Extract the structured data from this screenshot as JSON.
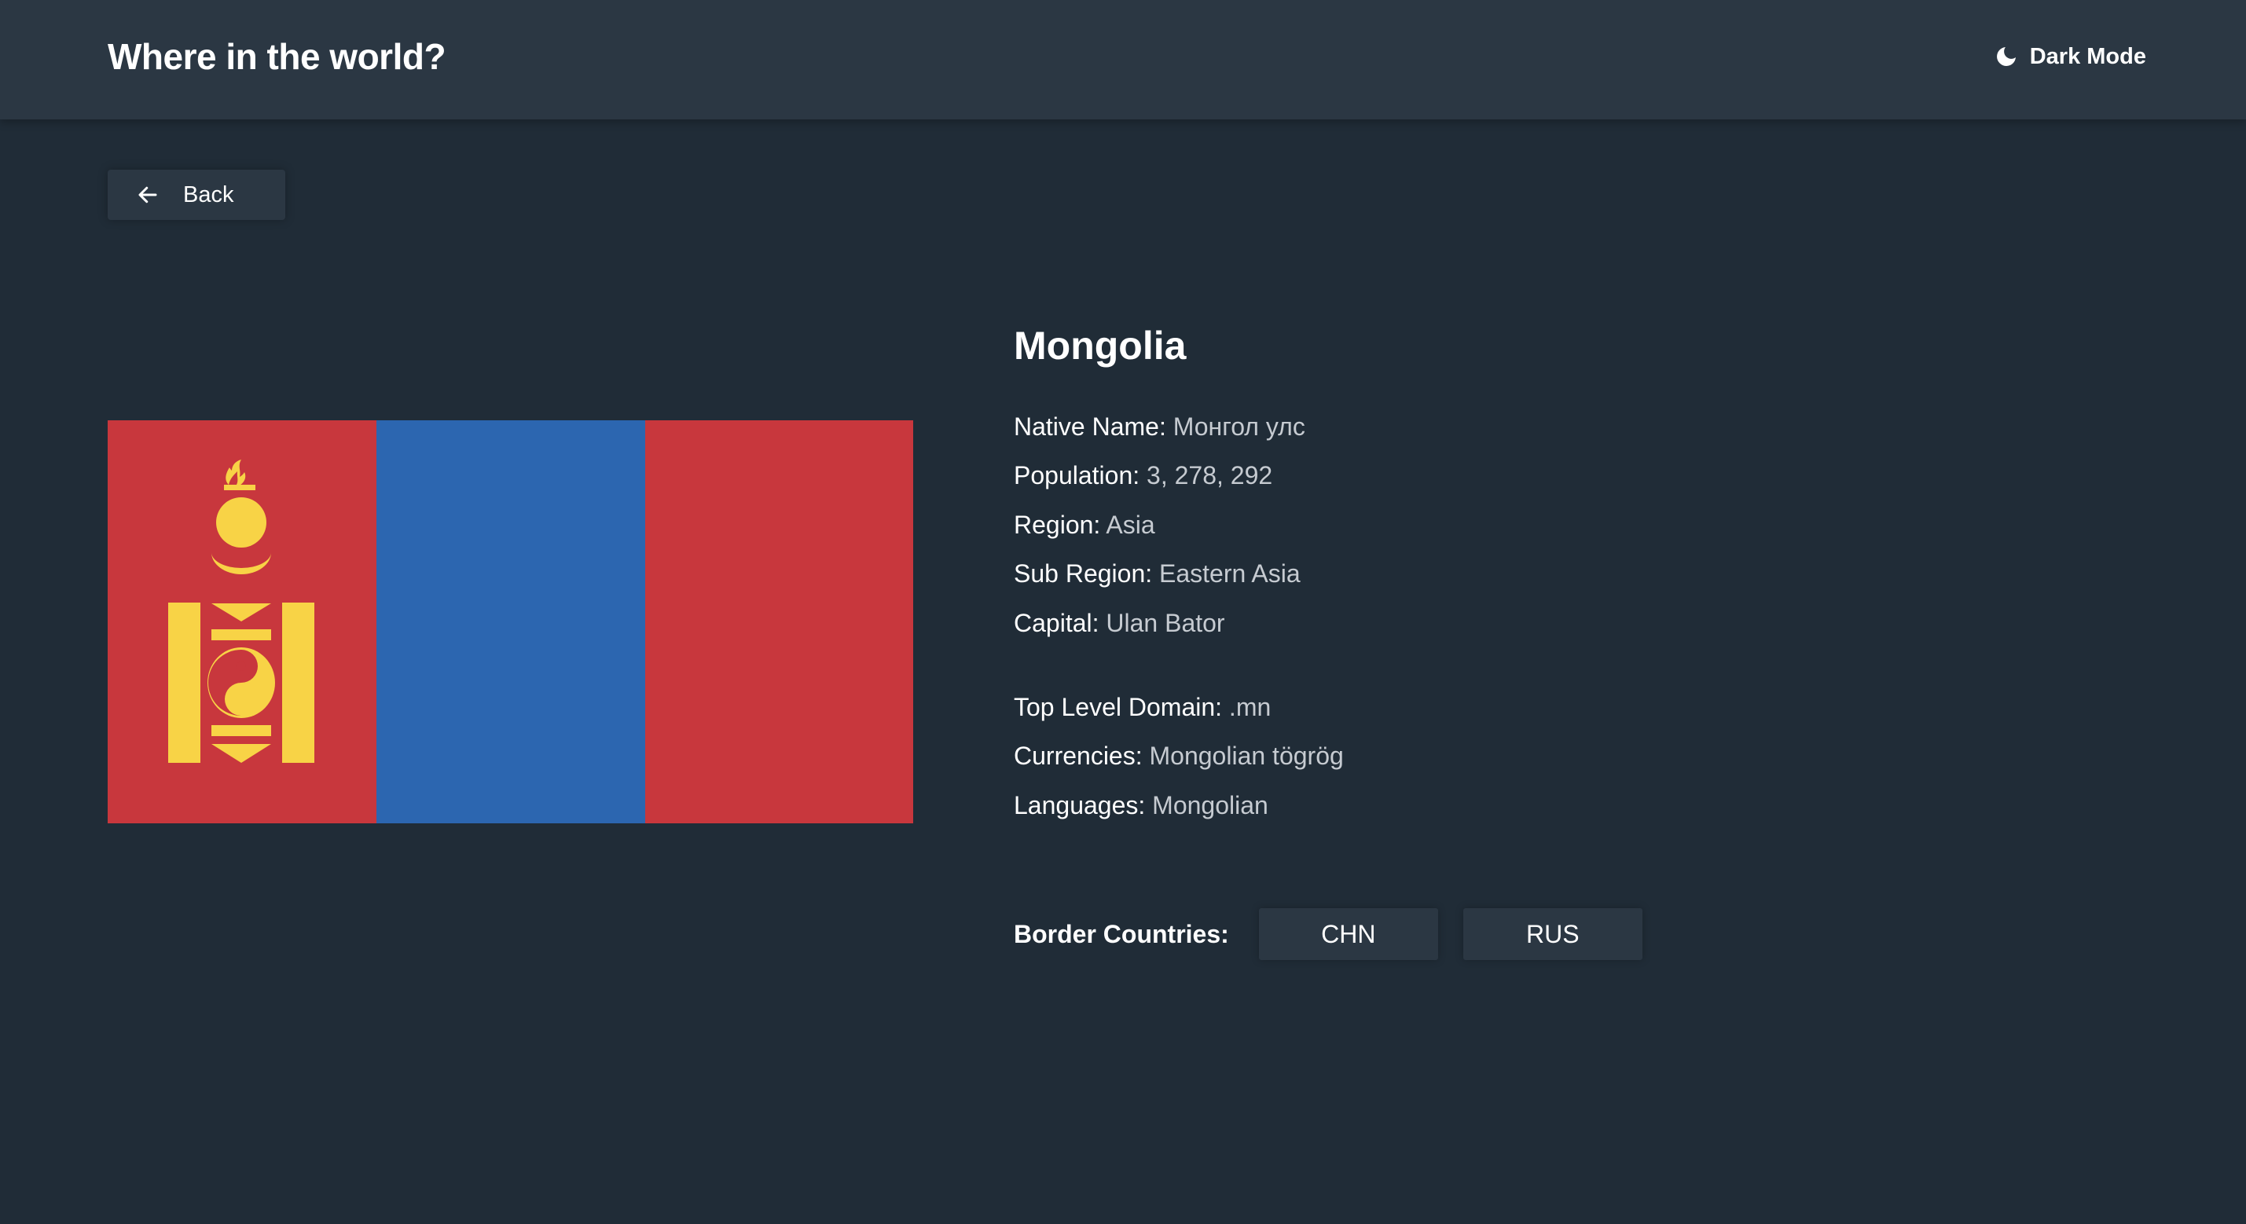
{
  "header": {
    "title": "Where in the world?",
    "theme_toggle_label": "Dark Mode",
    "theme_icon": "moon-icon"
  },
  "back_button": {
    "label": "Back",
    "icon": "arrow-left-icon"
  },
  "country": {
    "name": "Mongolia",
    "flag": {
      "colors": {
        "red": "#c8373d",
        "blue": "#2c66b0",
        "gold": "#f8d346"
      }
    },
    "details_primary": [
      {
        "label": "Native Name:",
        "value": "Монгол улс"
      },
      {
        "label": "Population:",
        "value": "3, 278, 292"
      },
      {
        "label": "Region:",
        "value": "Asia"
      },
      {
        "label": "Sub Region:",
        "value": "Eastern Asia"
      },
      {
        "label": "Capital:",
        "value": "Ulan Bator"
      }
    ],
    "details_secondary": [
      {
        "label": "Top Level Domain:",
        "value": ".mn"
      },
      {
        "label": "Currencies:",
        "value": "Mongolian tögrög"
      },
      {
        "label": "Languages:",
        "value": "Mongolian"
      }
    ],
    "border_countries_label": "Border Countries:",
    "border_countries": [
      "CHN",
      "RUS"
    ]
  },
  "colors": {
    "background": "#202c37",
    "element": "#2b3743",
    "text": "#ffffff",
    "muted_text": "#c6cbd1"
  }
}
